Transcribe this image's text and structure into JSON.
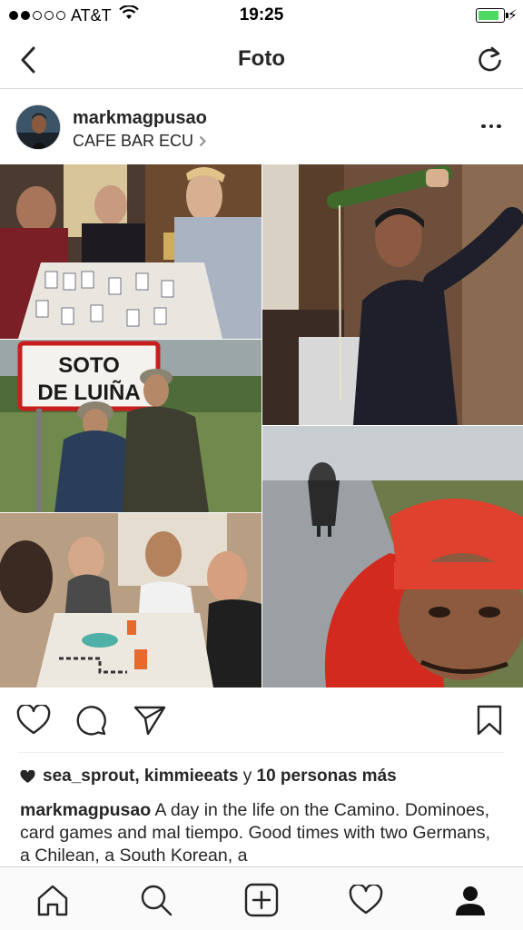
{
  "status_bar": {
    "carrier": "AT&T",
    "time": "19:25",
    "signal_bars_filled": 2,
    "signal_bars_total": 5,
    "battery_level": 0.85,
    "battery_color": "#4cd964"
  },
  "navbar": {
    "title": "Foto",
    "back_icon": "chevron-left-icon",
    "refresh_icon": "refresh-icon"
  },
  "post": {
    "username": "markmagpusao",
    "location": "CAFE BAR ECU",
    "sign_text": [
      "SOTO",
      "DE LUIÑA"
    ],
    "likes": {
      "users": "sea_sprout, kimmieeats",
      "connector": "y",
      "others": "10 personas más"
    },
    "caption": {
      "author": "markmagpusao",
      "text": "A day in the life on the Camino. Dominoes, card games and mal tiempo. Good times with two Germans, a Chilean, a South Korean, a"
    }
  },
  "actions": {
    "like_icon": "heart-outline-icon",
    "comment_icon": "comment-icon",
    "share_icon": "paper-plane-icon",
    "save_icon": "bookmark-icon"
  },
  "tabbar": {
    "items": [
      "home-icon",
      "search-icon",
      "add-icon",
      "activity-heart-icon",
      "profile-icon"
    ]
  }
}
